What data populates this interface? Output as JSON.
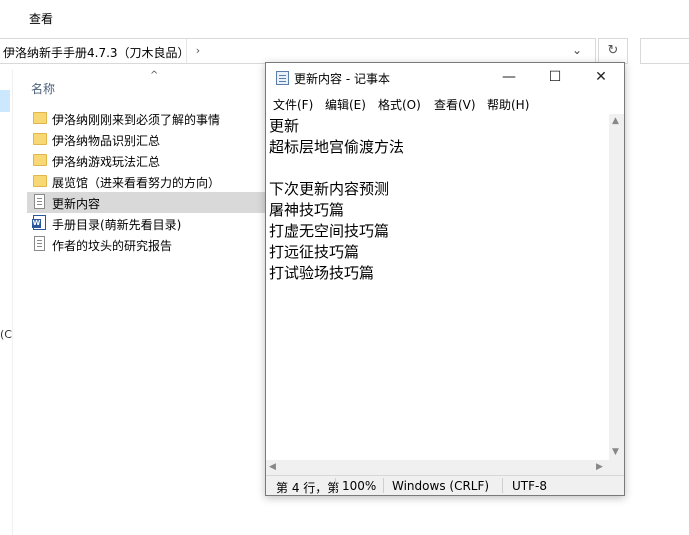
{
  "explorer": {
    "ribbon_tab": "查看",
    "address_path": "伊洛纳新手手册4.7.3（刀木良品）",
    "column_header": "名称",
    "nav_fragment": "(C",
    "files": [
      {
        "name": "伊洛纳刚刚来到必须了解的事情",
        "type": "folder"
      },
      {
        "name": "伊洛纳物品识别汇总",
        "type": "folder"
      },
      {
        "name": "伊洛纳游戏玩法汇总",
        "type": "folder"
      },
      {
        "name": "展览馆（进来看看努力的方向）",
        "type": "folder"
      },
      {
        "name": "更新内容",
        "type": "txt",
        "selected": true
      },
      {
        "name": "手册目录(萌新先看目录)",
        "type": "word"
      },
      {
        "name": "作者的坟头的研究报告",
        "type": "txt"
      }
    ]
  },
  "notepad": {
    "title": "更新内容 - 记事本",
    "menu": [
      "文件(F)",
      "编辑(E)",
      "格式(O)",
      "查看(V)",
      "帮助(H)"
    ],
    "lines": [
      "更新",
      "超标层地宫偷渡方法",
      "",
      "下次更新内容预测",
      "屠神技巧篇",
      "打虚无空间技巧篇",
      "打远征技巧篇",
      "打试验场技巧篇"
    ],
    "status": {
      "position": "第 4 行，第",
      "zoom": "100%",
      "line_ending": "Windows (CRLF)",
      "encoding": "UTF-8"
    }
  }
}
